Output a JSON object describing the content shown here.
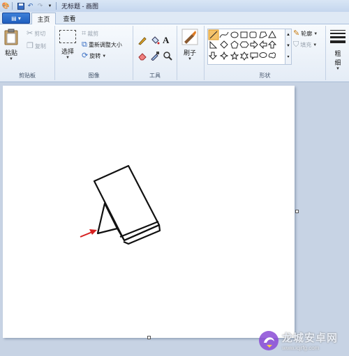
{
  "window": {
    "title": "无标题 - 画图"
  },
  "tabs": {
    "home": "主页",
    "view": "查看"
  },
  "clipboard": {
    "paste": "粘贴",
    "cut": "剪切",
    "copy": "复制",
    "group_label": "剪贴板"
  },
  "image": {
    "select": "选择",
    "crop": "裁剪",
    "resize": "重新调整大小",
    "rotate": "旋转",
    "group_label": "图像"
  },
  "tools": {
    "group_label": "工具"
  },
  "brushes": {
    "label": "刷子"
  },
  "shapes": {
    "outline": "轮廓",
    "fill": "填充",
    "group_label": "形状"
  },
  "size": {
    "label": "粗",
    "label2": "细"
  },
  "watermark": {
    "brand": "龙城安卓网",
    "url": "www.lcjrfg.com"
  },
  "colors": {
    "accent": "#1f5fbf",
    "arrow": "#d62020"
  }
}
